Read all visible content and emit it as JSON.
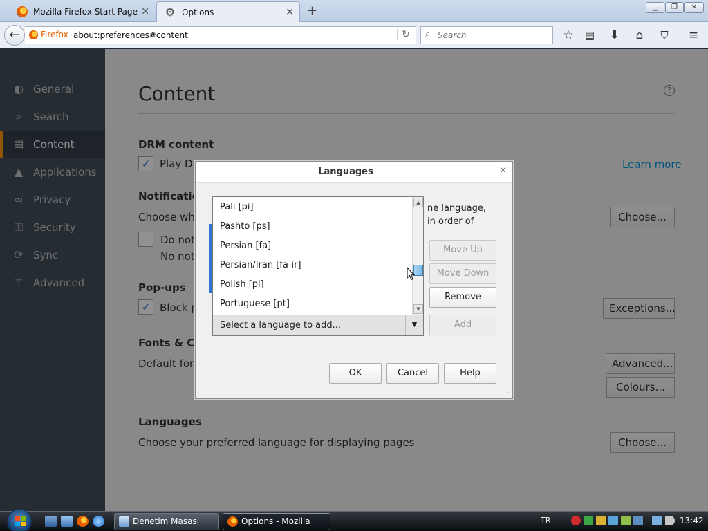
{
  "browser": {
    "tabs": [
      {
        "title": "Mozilla Firefox Start Page",
        "close": "✕"
      },
      {
        "title": "Options",
        "close": "✕"
      }
    ],
    "new_tab": "+",
    "url_identity": "Firefox",
    "url": "about:preferences#content",
    "search_placeholder": "Search"
  },
  "sidebar": {
    "items": [
      {
        "label": "General",
        "icon": "switch-icon"
      },
      {
        "label": "Search",
        "icon": "search-icon"
      },
      {
        "label": "Content",
        "icon": "document-icon"
      },
      {
        "label": "Applications",
        "icon": "rocket-icon"
      },
      {
        "label": "Privacy",
        "icon": "mask-icon"
      },
      {
        "label": "Security",
        "icon": "lock-icon"
      },
      {
        "label": "Sync",
        "icon": "sync-icon"
      },
      {
        "label": "Advanced",
        "icon": "wizard-icon"
      }
    ]
  },
  "content": {
    "title": "Content",
    "help": "?",
    "drm_heading": "DRM content",
    "drm_checkbox": "Play DR",
    "learn_more": "Learn more",
    "notifications_heading": "Notificatio",
    "notifications_text": "Choose whic",
    "notifications_choose": "Choose...",
    "dnd_label": "Do not",
    "dnd_sub": "No noti",
    "popups_heading": "Pop-ups",
    "popups_checkbox": "Block p",
    "popups_exceptions": "Exceptions...",
    "fonts_heading": "Fonts & Co",
    "fonts_text": "Default font",
    "fonts_advanced": "Advanced...",
    "fonts_colours": "Colours...",
    "languages_heading": "Languages",
    "languages_text": "Choose your preferred language for displaying pages",
    "languages_choose": "Choose..."
  },
  "dialog": {
    "title": "Languages",
    "close": "×",
    "description_line1": "ne language,",
    "description_line2": "in order of",
    "move_up": "Move Up",
    "move_down": "Move Down",
    "remove": "Remove",
    "add": "Add",
    "select_placeholder": "Select a language to add...",
    "ok": "OK",
    "cancel": "Cancel",
    "help": "Help",
    "language_options": [
      "Pali  [pi]",
      "Pashto  [ps]",
      "Persian  [fa]",
      "Persian/Iran  [fa-ir]",
      "Polish  [pl]",
      "Portuguese  [pt]"
    ]
  },
  "taskbar": {
    "tasks": [
      {
        "label": "Denetim Masası"
      },
      {
        "label": "Options - Mozilla Fir..."
      }
    ],
    "language": "TR",
    "clock": "13:42"
  }
}
